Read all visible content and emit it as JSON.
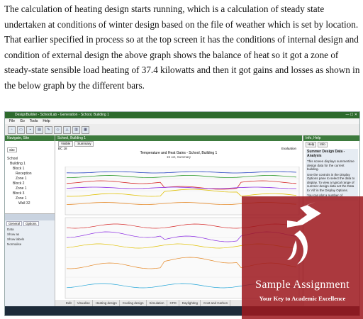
{
  "paragraph": [
    "The calculation of heating design starts running, which is a calculation of steady state",
    "undertaken at conditions of winter design based on the file of weather which is set by location.",
    "That earlier specified in process so at the top screen it has the conditions of internal design and",
    "condition of external design the above graph shows the balance of heat so it got a zone of",
    "steady-state sensible load heating of 37.4 kilowatts and then it got gains and losses as shown in",
    "the below graph by the different bars."
  ],
  "screenshot": {
    "title": "DesignBuilder - SchoolLab - Generation - School, Building 1",
    "menu": [
      "File",
      "Go",
      "Tools",
      "Help"
    ],
    "left_header": "Navigate, Site",
    "left_tab": "Site",
    "tree": [
      "School",
      "Building 1",
      "Block 1",
      "Reception",
      "Zone 1",
      "Block 2",
      "Zone 1",
      "Block 3",
      "Zone 1",
      "Wall 32"
    ],
    "lower_tabs": [
      "General",
      "Options"
    ],
    "fields": [
      "Data",
      "Show as",
      "Show labels",
      "Normalise"
    ],
    "center_header": "School, Building 1",
    "center_tabs": [
      "Visible",
      "Summary"
    ],
    "graph_title": "Temperature and Heat Gains - School, Building 1",
    "graph_subtitle": "15 oct, Summary",
    "graph_left_label": "BC 18",
    "graph_right_label": "Evaluation",
    "bottom_tabs": [
      "Edit",
      "Visualise",
      "Heating design",
      "Cooling design",
      "Simulation",
      "CFD",
      "Daylighting",
      "Cost and Carbon"
    ],
    "right_header": "Info, Help",
    "right_tabs": [
      "Help",
      "Info"
    ],
    "help_title": "Summer Design Data - Analysis",
    "help_text": [
      "This screen displays summertime design data for the current building.",
      "Use the controls in the Display Options pane to select the data to display. To view a typical range of summer design data set the Data to 'All' in the Display Options.",
      "You can plot a number of"
    ],
    "series_colors": [
      "#1f3fbf",
      "#2e9a2e",
      "#d62a2a",
      "#8a2be2",
      "#e0c000",
      "#e58a2a",
      "#1ea3d6",
      "#9aa0a8"
    ]
  },
  "watermark": {
    "name": "Sample Assignment",
    "tagline": "Your Key to Academic Excellence"
  }
}
